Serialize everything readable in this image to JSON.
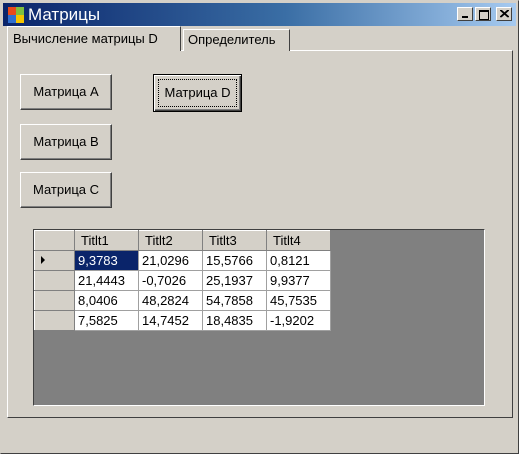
{
  "window": {
    "title": "Матрицы",
    "icon": "windows-forms-app-icon",
    "controls": [
      "minimize-icon",
      "maximize-icon",
      "close-icon"
    ]
  },
  "tabs": [
    {
      "label": "Вычисление матрицы D",
      "active": true
    },
    {
      "label": "Определитель",
      "active": false
    }
  ],
  "buttons": {
    "matrix_a": "Матрица A",
    "matrix_b": "Матрица B",
    "matrix_c": "Матрица C",
    "matrix_d": "Матрица D"
  },
  "grid": {
    "columns": [
      "Titlt1",
      "Titlt2",
      "Titlt3",
      "Titlt4"
    ],
    "rows": [
      [
        "9,3783",
        "21,0296",
        "15,5766",
        "0,8121"
      ],
      [
        "21,4443",
        "-0,7026",
        "25,1937",
        "9,9377"
      ],
      [
        "8,0406",
        "48,2824",
        "54,7858",
        "45,7535"
      ],
      [
        "7,5825",
        "14,7452",
        "18,4835",
        "-1,9202"
      ]
    ],
    "selected_cell": "9,3783",
    "colors": {
      "selection": "#0a246a",
      "background": "#808080"
    }
  },
  "colors": {
    "titlebar_start": "#0a246a",
    "titlebar_end": "#a6caf0",
    "face": "#d4d0c8"
  }
}
